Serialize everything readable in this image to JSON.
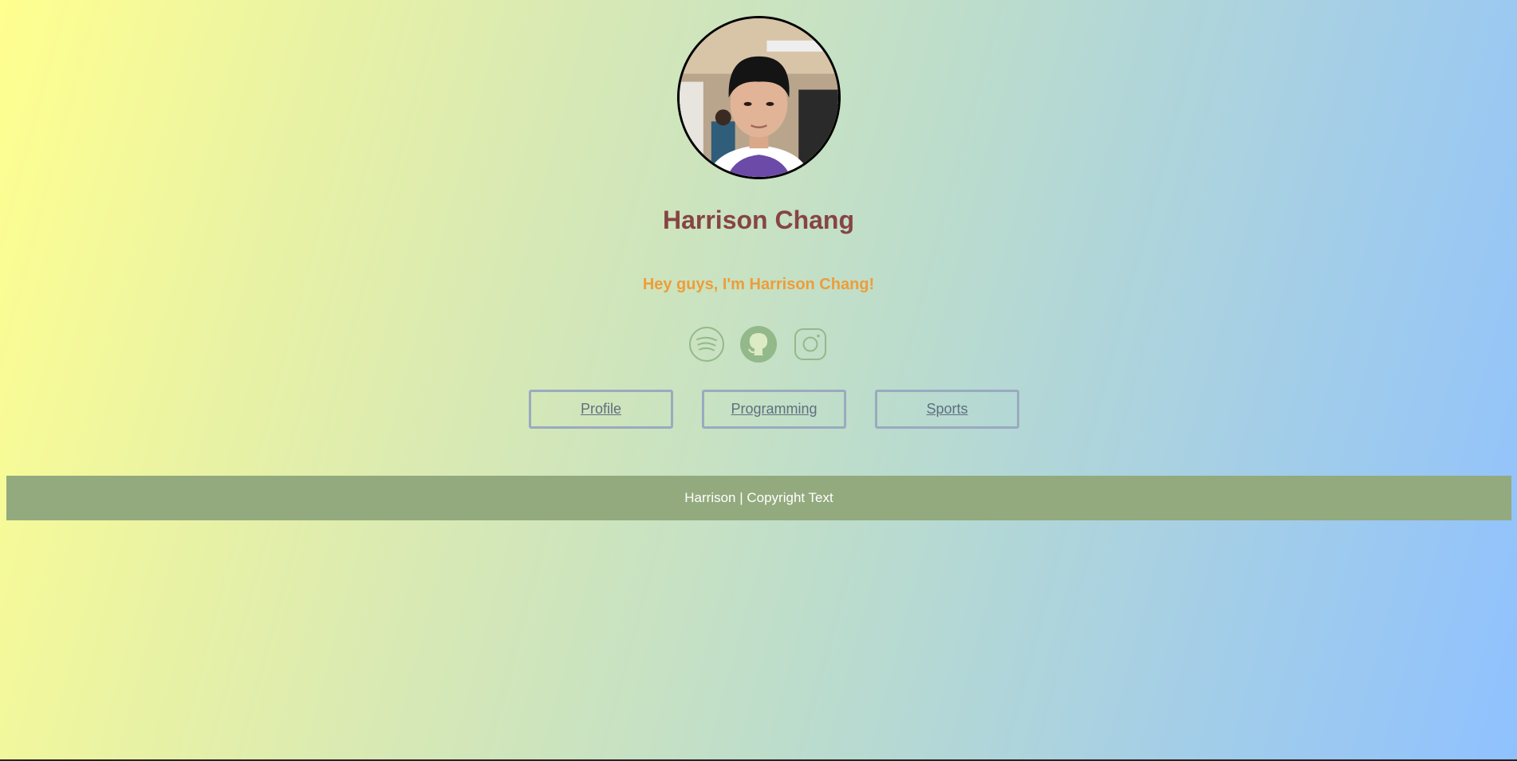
{
  "profile": {
    "name": "Harrison Chang",
    "greeting": "Hey guys, I'm Harrison Chang!"
  },
  "socials": [
    {
      "icon": "spotify-icon"
    },
    {
      "icon": "github-icon"
    },
    {
      "icon": "instagram-icon"
    }
  ],
  "nav": {
    "items": [
      {
        "label": "Profile"
      },
      {
        "label": "Programming"
      },
      {
        "label": "Sports"
      }
    ]
  },
  "footer": {
    "text": "Harrison | Copyright Text"
  },
  "colors": {
    "name": "#874444",
    "greeting": "#ee9d39",
    "icon": "#93b98a",
    "footer_bg": "#93aa7e",
    "button_border": "#9aaabf",
    "gradient_start": "#ffff8f",
    "gradient_end": "#8fc1ff"
  }
}
